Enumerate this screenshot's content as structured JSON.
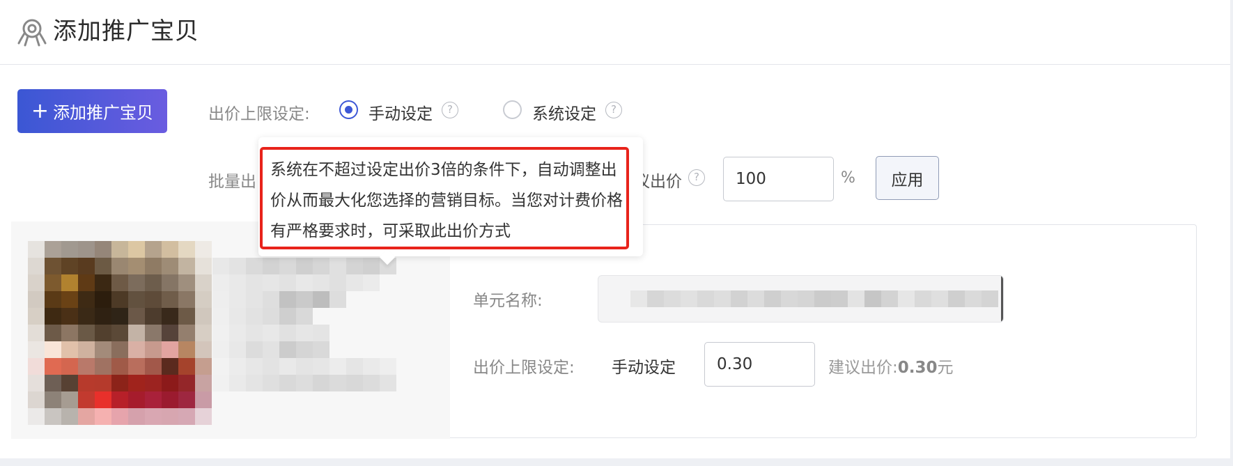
{
  "header": {
    "title": "添加推广宝贝",
    "icon": "octopus-logo-icon"
  },
  "toolbar": {
    "add_button_plus": "+",
    "add_button_label": "添加推广宝贝"
  },
  "bid_limit": {
    "label": "出价上限设定:",
    "options": [
      {
        "label": "手动设定",
        "selected": true
      },
      {
        "label": "系统设定",
        "selected": false
      }
    ],
    "help_glyph": "?"
  },
  "batch": {
    "label_visible": "批量出",
    "suggest_label_visible": "建议出价",
    "percent_value": "100",
    "percent_unit": "%",
    "apply_label": "应用"
  },
  "tooltip": {
    "text": "系统在不超过设定出价3倍的条件下，自动调整出价从而最大化您选择的营销目标。当您对计费价格有严格要求时，可采取此出价方式"
  },
  "item": {
    "unit_name_label": "单元名称:",
    "bid_label": "出价上限设定:",
    "bid_mode": "手动设定",
    "bid_value": "0.30",
    "suggest_prefix": "建议出价:",
    "suggest_value": "0.30",
    "suggest_unit": "元"
  },
  "colors": {
    "accent": "#3d57d6",
    "button_gradient_start": "#3b57d4",
    "button_gradient_end": "#6a5ce0",
    "tooltip_border": "#e8231b"
  }
}
